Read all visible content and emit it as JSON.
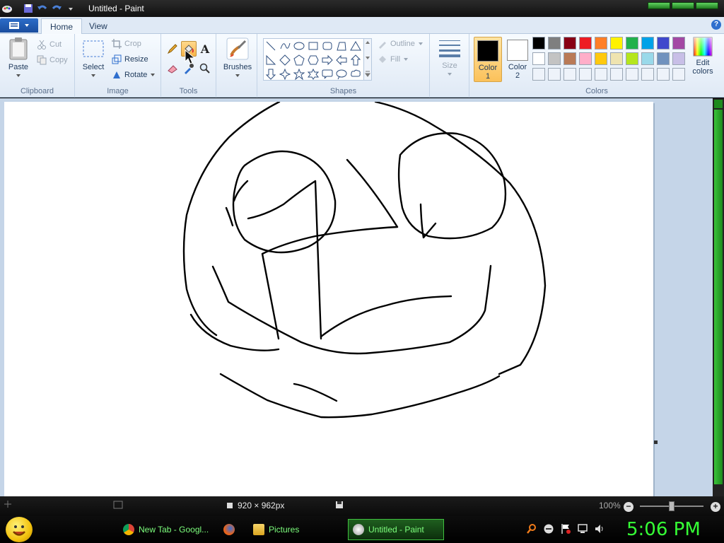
{
  "window": {
    "title": "Untitled - Paint"
  },
  "ribbon": {
    "tabs": [
      {
        "label": "Home",
        "active": true
      },
      {
        "label": "View",
        "active": false
      }
    ],
    "clipboard": {
      "label": "Clipboard",
      "paste": "Paste",
      "cut": "Cut",
      "copy": "Copy"
    },
    "image": {
      "label": "Image",
      "select": "Select",
      "crop": "Crop",
      "resize": "Resize",
      "rotate": "Rotate"
    },
    "tools": {
      "label": "Tools",
      "active_tool": "fill"
    },
    "brushes": {
      "label": "Brushes"
    },
    "shapes": {
      "label": "Shapes",
      "outline": "Outline",
      "fill": "Fill"
    },
    "size": {
      "label": "Size"
    },
    "colors": {
      "label": "Colors",
      "color1_label": "Color",
      "color1_num": "1",
      "color2_label": "Color",
      "color2_num": "2",
      "edit_label": "Edit",
      "edit_label2": "colors",
      "color1": "#000000",
      "color2": "#ffffff",
      "palette": [
        "#000000",
        "#7f7f7f",
        "#880015",
        "#ed1c24",
        "#ff7f27",
        "#fff200",
        "#22b14c",
        "#00a2e8",
        "#3f48cc",
        "#a349a4",
        "#ffffff",
        "#c3c3c3",
        "#b97a57",
        "#ffaec9",
        "#ffc90e",
        "#efe4b0",
        "#b5e61d",
        "#99d9ea",
        "#7092be",
        "#c8bfe7",
        "#eef3fa",
        "#eef3fa",
        "#eef3fa",
        "#eef3fa",
        "#eef3fa",
        "#eef3fa",
        "#eef3fa",
        "#eef3fa",
        "#eef3fa",
        "#eef3fa"
      ]
    }
  },
  "status": {
    "dimensions": "920 × 962px",
    "zoom": "100%"
  },
  "taskbar": {
    "tasks": [
      {
        "label": "New Tab - Googl...",
        "icon": "chrome-icon"
      },
      {
        "label": "",
        "icon": "firefox-icon"
      },
      {
        "label": "Pictures",
        "icon": "folder-icon"
      },
      {
        "label": "Untitled - Paint",
        "icon": "paint-icon",
        "active": true
      }
    ],
    "clock": "5:06 PM"
  }
}
